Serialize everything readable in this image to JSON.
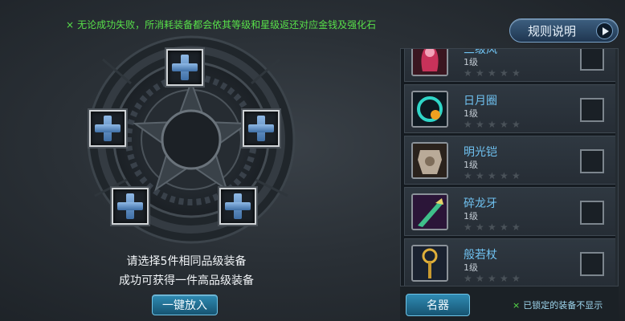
{
  "top_notice": "无论成功失败，所消耗装备都会依其等级和星级返还对应金钱及强化石",
  "rules_button": "规则说明",
  "hint_line1": "请选择5件相同品级装备",
  "hint_line2": "成功可获得一件高品级装备",
  "put_all_button": "一键放入",
  "filter_button": "名器",
  "locked_note": "已锁定的装备不显示",
  "colors": {
    "notice_green": "#58e04a",
    "item_name_blue": "#6fc1f0",
    "button_blue": "#2f8bb3"
  },
  "items": [
    {
      "name": "三级风",
      "level": "1级",
      "stars": 5,
      "icon": "red-robe-icon",
      "checked": false
    },
    {
      "name": "日月圈",
      "level": "1级",
      "stars": 5,
      "icon": "sun-moon-ring-icon",
      "checked": false
    },
    {
      "name": "明光铠",
      "level": "1级",
      "stars": 5,
      "icon": "armor-icon",
      "checked": false
    },
    {
      "name": "碎龙牙",
      "level": "1级",
      "stars": 5,
      "icon": "dragon-fang-icon",
      "checked": false
    },
    {
      "name": "般若杖",
      "level": "1级",
      "stars": 5,
      "icon": "staff-icon",
      "checked": false
    }
  ]
}
